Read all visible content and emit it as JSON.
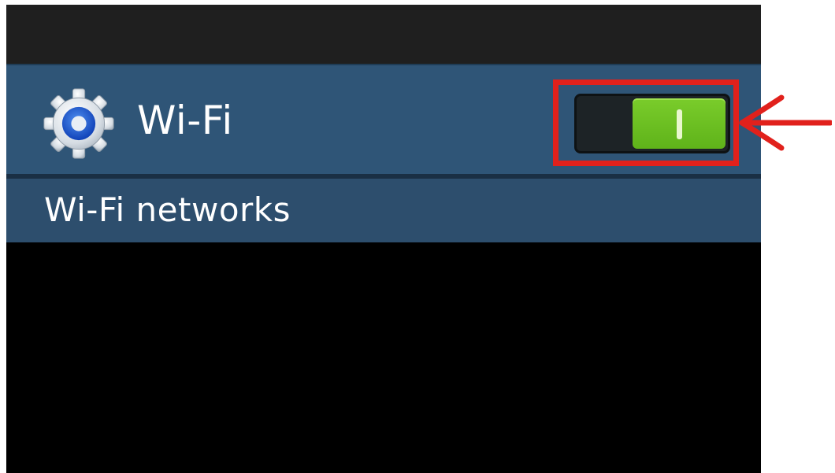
{
  "wifi": {
    "label": "Wi-Fi",
    "toggle_state": "on",
    "toggle_color": "#6cbf22",
    "icon": "gear-icon"
  },
  "section": {
    "networks_label": "Wi-Fi networks"
  },
  "annotation": {
    "highlight_color": "#e1211c",
    "arrow_icon": "left-arrow-icon"
  },
  "colors": {
    "status_bar": "#1f1f1f",
    "row_background": "#2f5577",
    "section_background": "#2d4e6d"
  }
}
